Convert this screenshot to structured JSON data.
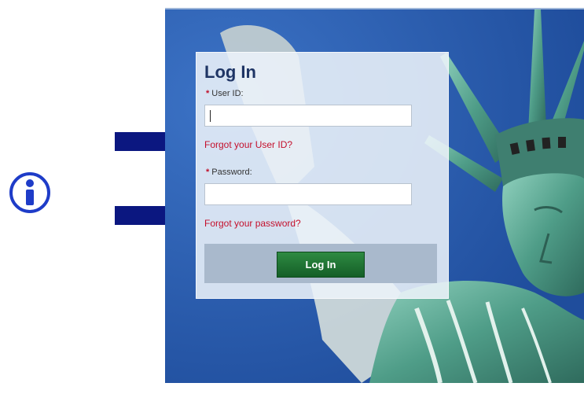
{
  "login_panel": {
    "title": "Log In",
    "required_marker": "*",
    "user_id_label": "User ID:",
    "user_id_value": "",
    "forgot_user_id_link": "Forgot your User ID?",
    "password_label": "Password:",
    "password_value": "",
    "forgot_password_link": "Forgot your password?",
    "login_button_label": "Log In"
  },
  "annotations": {
    "info_icon": "info-icon",
    "arrows": [
      "arrow-right-icon",
      "arrow-right-icon"
    ]
  },
  "colors": {
    "title": "#1f3565",
    "required_marker": "#c0102a",
    "link": "#c4102c",
    "button": "#1d6e30",
    "button_bar": "#a9b9cc",
    "sky": "#2a5aa8",
    "info_icon": "#1e3cc8",
    "arrow": "#0b1780"
  }
}
